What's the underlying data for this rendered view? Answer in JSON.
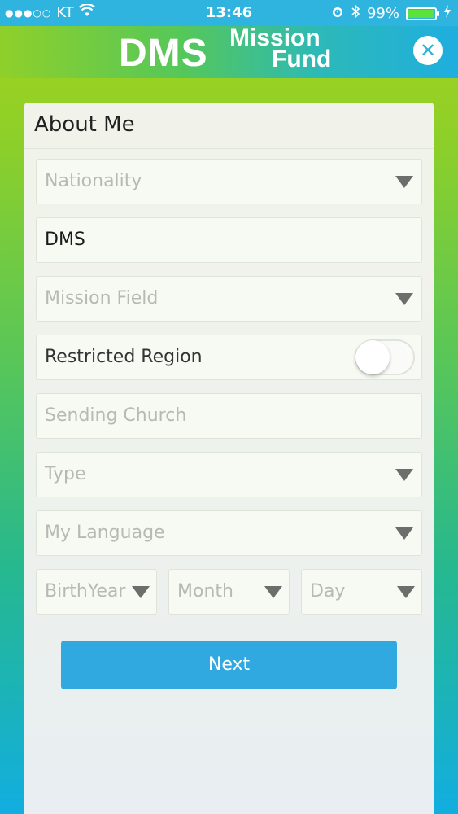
{
  "status_bar": {
    "signal": "●●●○○",
    "carrier": "KT",
    "time": "13:46",
    "battery_percent": "99%",
    "icons": [
      "wifi-icon",
      "alarm-icon",
      "bluetooth-icon",
      "battery-icon",
      "charging-icon"
    ]
  },
  "header": {
    "logo_left": "DMS",
    "logo_right_line1": "Mission",
    "logo_right_line2": "Fund",
    "close_icon": "close-icon"
  },
  "form": {
    "title": "About Me",
    "nationality_placeholder": "Nationality",
    "name_value": "DMS",
    "mission_field_placeholder": "Mission Field",
    "restricted_region_label": "Restricted Region",
    "restricted_region_on": false,
    "sending_church_placeholder": "Sending Church",
    "type_placeholder": "Type",
    "my_language_placeholder": "My Language",
    "birth_year_placeholder": "BirthYear",
    "month_placeholder": "Month",
    "day_placeholder": "Day",
    "next_label": "Next"
  },
  "colors": {
    "status_bar": "#2fb3df",
    "button": "#2fa9df",
    "gradient_top": "#a6d31a",
    "gradient_bottom": "#12aee0"
  }
}
